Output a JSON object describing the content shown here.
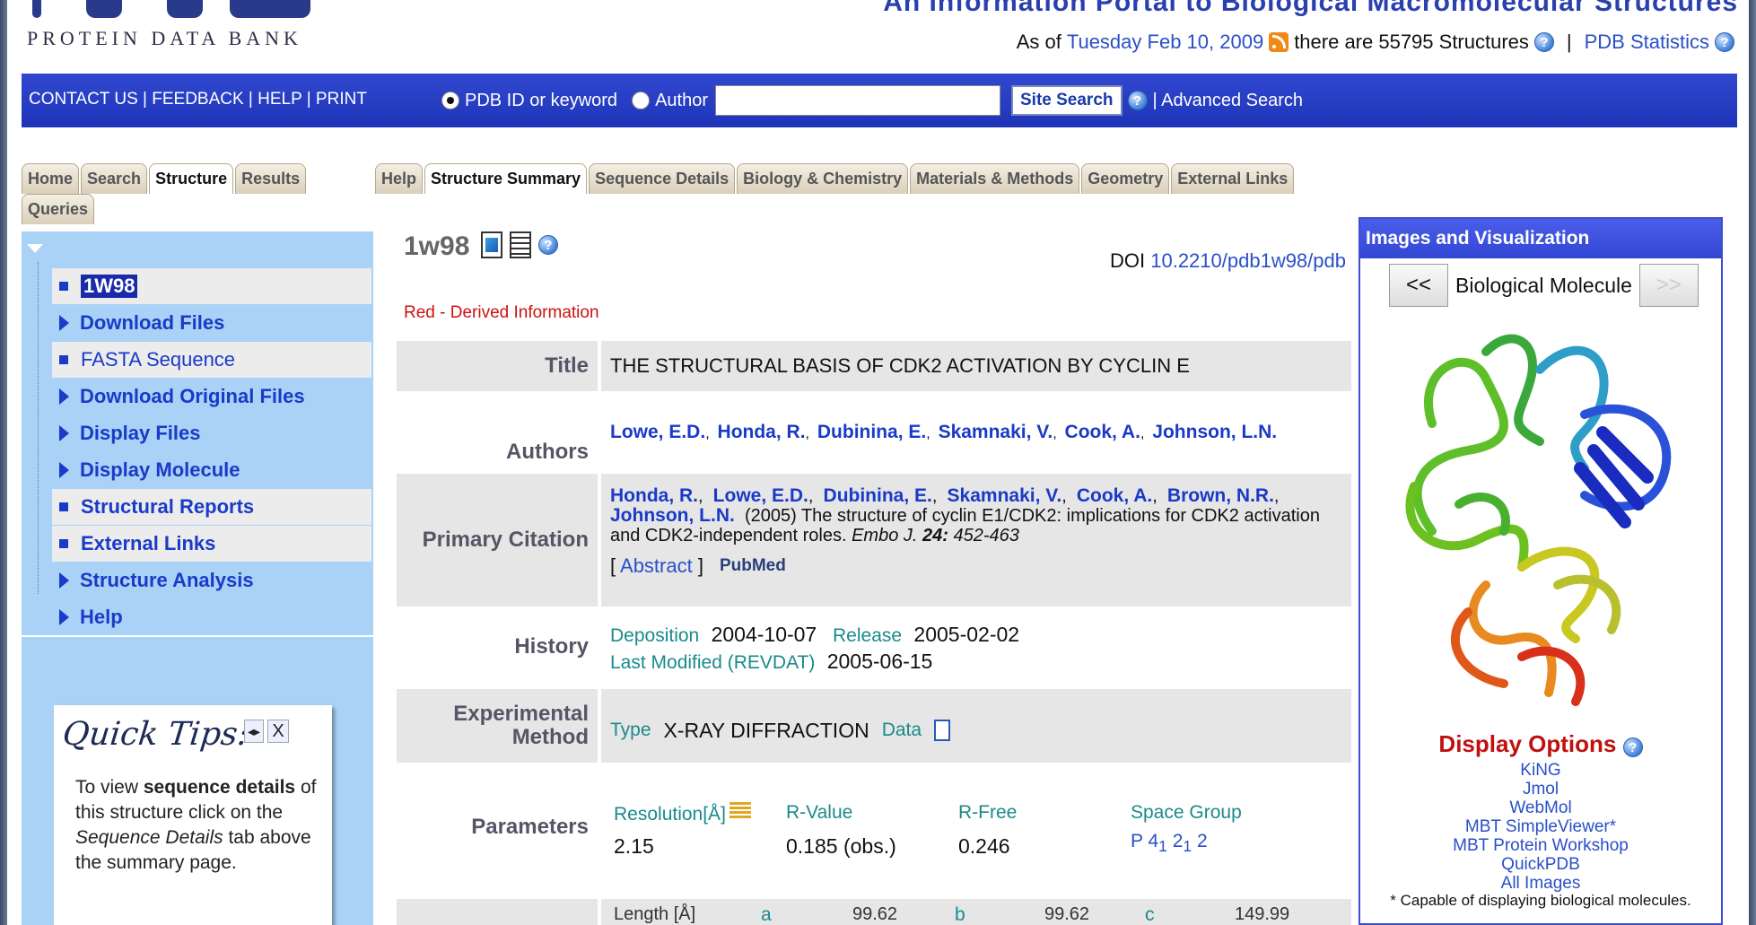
{
  "header": {
    "logo_text": "PROTEIN DATA BANK",
    "title": "An Information Portal to Biological Macromolecular Structures",
    "status_prefix": "As of",
    "status_date": "Tuesday Feb 10, 2009",
    "status_count": "there are 55795 Structures",
    "separator": "|",
    "stats_link": "PDB Statistics"
  },
  "bluebar": {
    "links": "CONTACT US | FEEDBACK | HELP | PRINT",
    "radio_keyword": "PDB ID or keyword",
    "radio_author": "Author",
    "search_value": "",
    "search_button": "Site Search",
    "advanced": "| Advanced Search"
  },
  "left_tabs": [
    "Home",
    "Search",
    "Structure",
    "Results"
  ],
  "left_tab_queries": "Queries",
  "main_tabs": [
    "Help",
    "Structure Summary",
    "Sequence Details",
    "Biology & Chemistry",
    "Materials & Methods",
    "Geometry",
    "External Links"
  ],
  "sidebar": {
    "items": [
      {
        "label": "1W98",
        "marker": "square",
        "boxed": true,
        "selected": true
      },
      {
        "label": "Download Files",
        "marker": "triangle",
        "boxed": false
      },
      {
        "label": "FASTA Sequence",
        "marker": "square",
        "boxed": true
      },
      {
        "label": "Download Original Files",
        "marker": "triangle",
        "boxed": false
      },
      {
        "label": "Display Files",
        "marker": "triangle",
        "boxed": false
      },
      {
        "label": "Display Molecule",
        "marker": "triangle",
        "boxed": false
      },
      {
        "label": "Structural Reports",
        "marker": "square",
        "boxed": true
      },
      {
        "label": "External Links",
        "marker": "square",
        "boxed": true
      },
      {
        "label": "Structure Analysis",
        "marker": "triangle",
        "boxed": false
      },
      {
        "label": "Help",
        "marker": "triangle",
        "boxed": false
      }
    ]
  },
  "quick_tips": {
    "title": "Quick Tips:",
    "nav_close": "X",
    "text_1": "To view ",
    "text_bold": "sequence details",
    "text_2": " of this structure click on the ",
    "text_italic": "Sequence Details",
    "text_3": " tab above the summary page."
  },
  "summary": {
    "pdb_id": "1w98",
    "doi_prefix": "DOI",
    "doi": "10.2210/pdb1w98/pdb",
    "derived_note": "Red - Derived Information",
    "title_label": "Title",
    "title": "THE STRUCTURAL BASIS OF CDK2 ACTIVATION BY CYCLIN E",
    "authors_label": "Authors",
    "authors": [
      "Lowe, E.D.",
      "Honda, R.",
      "Dubinina, E.",
      "Skamnaki, V.",
      "Cook, A.",
      "Johnson, L.N."
    ],
    "citation_label": "Primary Citation",
    "citation_authors": [
      "Honda, R.",
      "Lowe, E.D.",
      "Dubinina, E.",
      "Skamnaki, V.",
      "Cook, A.",
      "Brown, N.R.",
      "Johnson, L.N."
    ],
    "citation_text": "(2005) The structure of cyclin E1/CDK2: implications for CDK2 activation and CDK2-independent roles.",
    "journal": "Embo J.",
    "volume": "24:",
    "pages": "452-463",
    "abstract": "Abstract",
    "pubmed": "PubMed",
    "history_label": "History",
    "deposition_label": "Deposition",
    "deposition": "2004-10-07",
    "release_label": "Release",
    "release": "2005-02-02",
    "modified_label": "Last Modified (REVDAT)",
    "modified": "2005-06-15",
    "method_label_1": "Experimental",
    "method_label_2": "Method",
    "type_label": "Type",
    "method": "X-RAY DIFFRACTION",
    "data_label": "Data",
    "params_label": "Parameters",
    "resolution_label": "Resolution[Å]",
    "resolution": "2.15",
    "rvalue_label": "R-Value",
    "rvalue": "0.185 (obs.)",
    "rfree_label": "R-Free",
    "rfree": "0.246",
    "spacegroup_label": "Space Group",
    "spacegroup_p": "P 4",
    "spacegroup_s1": "1",
    "spacegroup_2": " 2",
    "spacegroup_s2": "1",
    "spacegroup_3": " 2",
    "length_label": "Length [Å]",
    "a_label": "a",
    "a": "99.62",
    "b_label": "b",
    "b": "99.62",
    "c_label": "c",
    "c": "149.99"
  },
  "right_panel": {
    "title": "Images and Visualization",
    "prev": "<<",
    "next": ">>",
    "molecule_label": "Biological Molecule",
    "display_title": "Display Options",
    "options": [
      "KiNG",
      "Jmol",
      "WebMol",
      "MBT SimpleViewer*",
      "MBT Protein Workshop",
      "QuickPDB",
      "All Images"
    ],
    "note": "* Capable of displaying biological molecules."
  }
}
